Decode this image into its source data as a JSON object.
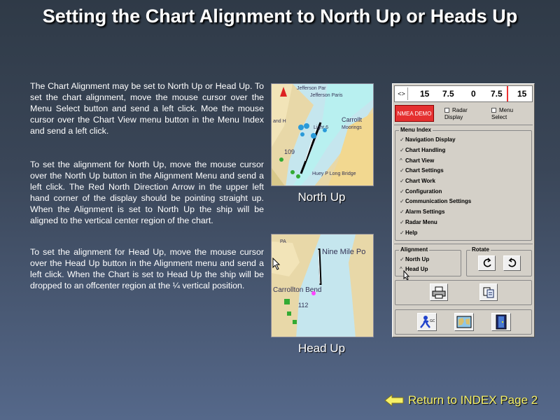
{
  "title": "Setting the Chart Alignment to North Up or Heads Up",
  "paragraphs": [
    "The Chart Alignment may be set to North Up or Head Up.  To set the chart alignment, move the mouse cursor over the Menu Select button and send a left click.  Moe the mouse cursor over the Chart View menu button in the Menu Index and send a left click.",
    "To set the alignment for North Up, move the mouse cursor over the North Up button in the Alignment Menu and send a left click.  The Red North Direction Arrow in the upper left hand corner of the display should be pointing straight up.  When the Alignment is set to North Up the ship will be aligned to the vertical center region of the chart.",
    "To set the alignment for Head Up, move the mouse cursor over the Head Up button in the Alignment menu and send a left click.  When the Chart is set to Head Up the ship will be dropped to an offcenter region at the ¼ vertical position."
  ],
  "charts": {
    "north_up": {
      "caption": "North Up",
      "labels": [
        "Jefferson Par",
        "Jefferson Paris",
        "Carrollt",
        "Light 6",
        "Moorings",
        "109",
        "Huey P Long Bridge",
        "and H"
      ]
    },
    "head_up": {
      "caption": "Head Up",
      "labels": [
        "PA",
        "Nine Mile Po",
        "Carrollton Bend",
        "112"
      ]
    }
  },
  "panel": {
    "scale_ticks": [
      "15",
      "7.5",
      "0",
      "7.5",
      "15"
    ],
    "arrow_label": "<>",
    "nmea_button": "NMEA DEMO",
    "radar_checkbox": "Radar Display",
    "menu_select_checkbox": "Menu Select",
    "menu_index": {
      "label": "Menu Index",
      "items": [
        "Navigation Display",
        "Chart Handling",
        "Chart View",
        "Chart Settings",
        "Chart Work",
        "Configuration",
        "Communication Settings",
        "Alarm Settings",
        "Radar Menu",
        "Help"
      ]
    },
    "alignment": {
      "label": "Alignment",
      "options": [
        "North Up",
        "Head Up"
      ]
    },
    "rotate": {
      "label": "Rotate"
    },
    "icons": [
      "rotate-left-icon",
      "rotate-right-icon",
      "printer-icon",
      "copy-icon",
      "person-icon",
      "map-icon",
      "exit-door-icon"
    ]
  },
  "return_link": "Return to INDEX Page 2",
  "colors": {
    "accent_link": "#f6f066",
    "nmea_red": "#e53030",
    "scale_marker": "#e33"
  }
}
